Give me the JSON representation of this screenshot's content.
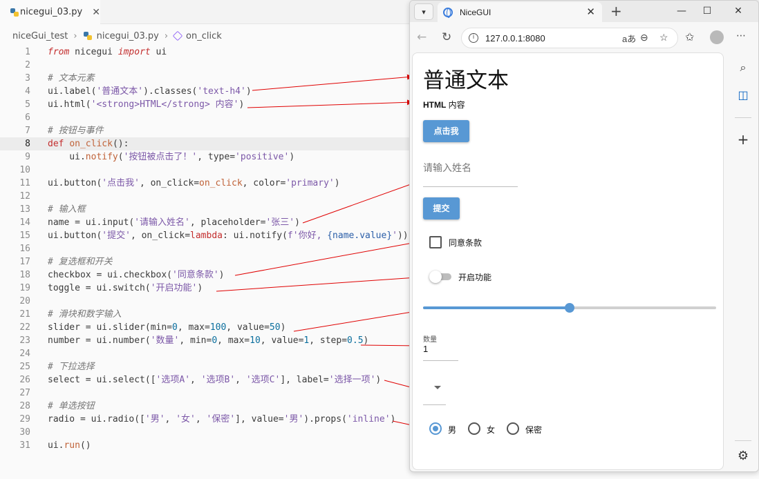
{
  "editor": {
    "tab_name": "nicegui_03.py",
    "breadcrumb": [
      "niceGui_test",
      "nicegui_03.py",
      "on_click"
    ],
    "current_line": 8
  },
  "browser": {
    "tab_title": "NiceGUI",
    "url": "127.0.0.1:8080",
    "read_aloud": "aあ"
  },
  "page": {
    "h4_label": "普通文本",
    "html_bold": "HTML",
    "html_rest": " 内容",
    "button_label": "点击我",
    "input_placeholder": "请输入姓名",
    "submit_label": "提交",
    "checkbox_label": "同意条款",
    "switch_label": "开启功能",
    "slider": {
      "min": 0,
      "max": 100,
      "value": 50
    },
    "number_label": "数量",
    "number_value": "1",
    "radio_options": [
      "男",
      "女",
      "保密"
    ],
    "radio_selected": "男"
  },
  "code_lines": [
    {
      "n": "1",
      "parts": [
        [
          "from",
          "k-kw k-it"
        ],
        [
          " nicegui ",
          ""
        ],
        [
          "import",
          "k-kw k-it"
        ],
        [
          " ui",
          ""
        ]
      ]
    },
    {
      "n": "2",
      "parts": []
    },
    {
      "n": "3",
      "parts": [
        [
          "# 文本元素",
          "k-cm"
        ]
      ]
    },
    {
      "n": "4",
      "parts": [
        [
          "ui.label(",
          ""
        ],
        [
          "'普通文本'",
          "k-str"
        ],
        [
          ").classes(",
          ""
        ],
        [
          "'text-h4'",
          "k-str"
        ],
        [
          ")",
          ""
        ]
      ]
    },
    {
      "n": "5",
      "parts": [
        [
          "ui.html(",
          ""
        ],
        [
          "'<strong>HTML</strong> 内容'",
          "k-str"
        ],
        [
          ")",
          ""
        ]
      ]
    },
    {
      "n": "6",
      "parts": []
    },
    {
      "n": "7",
      "parts": [
        [
          "# 按钮与事件",
          "k-cm"
        ]
      ]
    },
    {
      "n": "8",
      "parts": [
        [
          "def",
          "k-kw"
        ],
        [
          " ",
          ""
        ],
        [
          "on_click",
          "k-fn"
        ],
        [
          "():",
          ""
        ]
      ]
    },
    {
      "n": "9",
      "parts": [
        [
          "    ui.",
          ""
        ],
        [
          "notify",
          "k-fn"
        ],
        [
          "(",
          ""
        ],
        [
          "'按钮被点击了！'",
          "k-str"
        ],
        [
          ", type=",
          ""
        ],
        [
          "'positive'",
          "k-str"
        ],
        [
          ")",
          ""
        ]
      ]
    },
    {
      "n": "10",
      "parts": []
    },
    {
      "n": "11",
      "parts": [
        [
          "ui.button(",
          ""
        ],
        [
          "'点击我'",
          "k-str"
        ],
        [
          ", on_click=",
          ""
        ],
        [
          "on_click",
          "k-fn"
        ],
        [
          ", color=",
          ""
        ],
        [
          "'primary'",
          "k-str"
        ],
        [
          ")",
          ""
        ]
      ]
    },
    {
      "n": "12",
      "parts": []
    },
    {
      "n": "13",
      "parts": [
        [
          "# 输入框",
          "k-cm"
        ]
      ]
    },
    {
      "n": "14",
      "parts": [
        [
          "name = ui.input(",
          ""
        ],
        [
          "'请输入姓名'",
          "k-str"
        ],
        [
          ", placeholder=",
          ""
        ],
        [
          "'张三'",
          "k-str"
        ],
        [
          ")",
          ""
        ]
      ]
    },
    {
      "n": "15",
      "parts": [
        [
          "ui.button(",
          ""
        ],
        [
          "'提交'",
          "k-str"
        ],
        [
          ", on_click=",
          ""
        ],
        [
          "lambda",
          "k-kw"
        ],
        [
          ": ui.notify(",
          ""
        ],
        [
          "f'你好, ",
          "k-str"
        ],
        [
          "{name.value}",
          "k-id"
        ],
        [
          "'",
          "k-str"
        ],
        [
          "))",
          ""
        ]
      ]
    },
    {
      "n": "16",
      "parts": []
    },
    {
      "n": "17",
      "parts": [
        [
          "# 复选框和开关",
          "k-cm"
        ]
      ]
    },
    {
      "n": "18",
      "parts": [
        [
          "checkbox = ui.checkbox(",
          ""
        ],
        [
          "'同意条款'",
          "k-str"
        ],
        [
          ")",
          ""
        ]
      ]
    },
    {
      "n": "19",
      "parts": [
        [
          "toggle = ui.switch(",
          ""
        ],
        [
          "'开启功能'",
          "k-str"
        ],
        [
          ")",
          ""
        ]
      ]
    },
    {
      "n": "20",
      "parts": []
    },
    {
      "n": "21",
      "parts": [
        [
          "# 滑块和数字输入",
          "k-cm"
        ]
      ]
    },
    {
      "n": "22",
      "parts": [
        [
          "slider = ui.slider(min=",
          ""
        ],
        [
          "0",
          "k-num"
        ],
        [
          ", max=",
          ""
        ],
        [
          "100",
          "k-num"
        ],
        [
          ", value=",
          ""
        ],
        [
          "50",
          "k-num"
        ],
        [
          ")",
          ""
        ]
      ]
    },
    {
      "n": "23",
      "parts": [
        [
          "number = ui.number(",
          ""
        ],
        [
          "'数量'",
          "k-str"
        ],
        [
          ", min=",
          ""
        ],
        [
          "0",
          "k-num"
        ],
        [
          ", max=",
          ""
        ],
        [
          "10",
          "k-num"
        ],
        [
          ", value=",
          ""
        ],
        [
          "1",
          "k-num"
        ],
        [
          ", step=",
          ""
        ],
        [
          "0.5",
          "k-num"
        ],
        [
          ")",
          ""
        ]
      ]
    },
    {
      "n": "24",
      "parts": []
    },
    {
      "n": "25",
      "parts": [
        [
          "# 下拉选择",
          "k-cm"
        ]
      ]
    },
    {
      "n": "26",
      "parts": [
        [
          "select = ui.select([",
          ""
        ],
        [
          "'选项A'",
          "k-str"
        ],
        [
          ", ",
          ""
        ],
        [
          "'选项B'",
          "k-str"
        ],
        [
          ", ",
          ""
        ],
        [
          "'选项C'",
          "k-str"
        ],
        [
          "], label=",
          ""
        ],
        [
          "'选择一项'",
          "k-str"
        ],
        [
          ")",
          ""
        ]
      ]
    },
    {
      "n": "27",
      "parts": []
    },
    {
      "n": "28",
      "parts": [
        [
          "# 单选按钮",
          "k-cm"
        ]
      ]
    },
    {
      "n": "29",
      "parts": [
        [
          "radio = ui.radio([",
          ""
        ],
        [
          "'男'",
          "k-str"
        ],
        [
          ", ",
          ""
        ],
        [
          "'女'",
          "k-str"
        ],
        [
          ", ",
          ""
        ],
        [
          "'保密'",
          "k-str"
        ],
        [
          "], value=",
          ""
        ],
        [
          "'男'",
          "k-str"
        ],
        [
          ").props(",
          ""
        ],
        [
          "'inline'",
          "k-str"
        ],
        [
          ")",
          ""
        ]
      ]
    },
    {
      "n": "30",
      "parts": []
    },
    {
      "n": "31",
      "parts": [
        [
          "ui.",
          ""
        ],
        [
          "run",
          "k-fn"
        ],
        [
          "()",
          ""
        ]
      ]
    }
  ],
  "colors": {
    "arrow": "#e00000",
    "primary": "#5898d4",
    "editor_bg": "#fafafa"
  }
}
